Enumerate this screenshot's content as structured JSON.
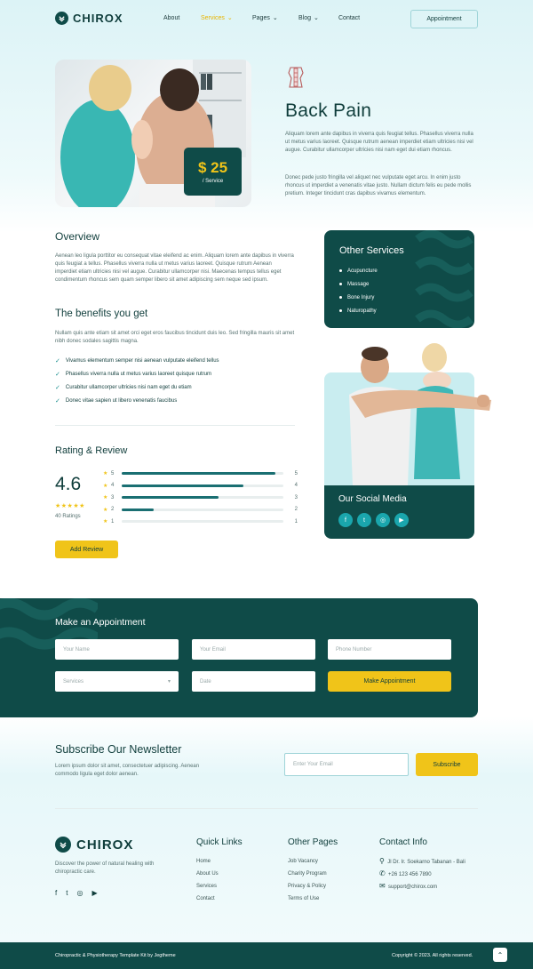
{
  "brand": {
    "name": "CHIROX"
  },
  "nav": {
    "items": [
      "About",
      "Services",
      "Pages",
      "Blog",
      "Contact"
    ],
    "active": "Services",
    "cta": "Appointment"
  },
  "hero": {
    "price": "$ 25",
    "price_unit": "/ Service",
    "title": "Back Pain",
    "p1": "Aliquam lorem ante dapibus in viverra quis feugiat tellus. Phasellus viverra nulla ut metus varius laoreet. Quisque rutrum aenean imperdiet etiam ultricies nisi vel augue. Curabitur ullamcorper ultricies nisi nam eget dui etiam rhoncus.",
    "p2": "Donec pede justo fringilla vel aliquet nec vulputate eget arcu. In enim justo rhoncus ut imperdiet a venenatis vitae justo. Nullam dictum felis eu pede mollis pretium. Integer tincidunt cras dapibus vivamus elementum."
  },
  "overview": {
    "title": "Overview",
    "text": "Aenean leo ligula porttitor eu consequat vitae eleifend ac enim. Aliquam lorem ante dapibus in viverra quis feugiat a tellus. Phasellus viverra nulla ut metus varius laoreet. Quisque rutrum Aenean imperdiet etiam ultricies nisi vel augue. Curabitur ullamcorper nisi. Maecenas tempus tellus eget condimentum rhoncus sem quam semper libero sit amet adipiscing sem neque sed ipsum."
  },
  "benefits": {
    "title": "The benefits you get",
    "text": "Nullam quis ante etiam sit amet orci eget eros faucibus tincidunt duis leo. Sed fringilla mauris sit amet nibh donec sodales sagittis magna.",
    "items": [
      "Vivamus elementum semper nisi aenean vulputate eleifend tellus",
      "Phasellus viverra nulla ut metus varius laoreet quisque rutrum",
      "Curabitur ullamcorper ultricies nisi nam eget du etiam",
      "Donec vitae sapien ut libero venenatis faucibus"
    ]
  },
  "rating": {
    "title": "Rating & Review",
    "score": "4.6",
    "count_label": "40 Ratings",
    "rows": [
      {
        "star": "5",
        "fill": 0.95,
        "count": "5"
      },
      {
        "star": "4",
        "fill": 0.75,
        "count": "4"
      },
      {
        "star": "3",
        "fill": 0.6,
        "count": "3"
      },
      {
        "star": "2",
        "fill": 0.2,
        "count": "2"
      },
      {
        "star": "1",
        "fill": 0.0,
        "count": "1"
      }
    ],
    "button": "Add Review"
  },
  "other_services": {
    "title": "Other Services",
    "items": [
      "Acupuncture",
      "Massage",
      "Bone Injury",
      "Naturopathy"
    ]
  },
  "social": {
    "title": "Our Social Media",
    "icons": [
      "f",
      "t",
      "◎",
      "▶"
    ]
  },
  "appointment": {
    "title": "Make an Appointment",
    "name_ph": "Your Name",
    "email_ph": "Your Email",
    "phone_ph": "Phone Number",
    "services_ph": "Services",
    "date_ph": "Date",
    "button": "Make Appointment"
  },
  "newsletter": {
    "title": "Subscribe Our Newsletter",
    "text": "Lorem ipsum dolor sit amet, consectetuer adipiscing. Aenean commodo ligula eget dolor aenean.",
    "email_ph": "Enter Your Email",
    "button": "Subscribe"
  },
  "footer": {
    "desc": "Discover the power of natural healing with chiropractic care.",
    "quick_title": "Quick Links",
    "quick": [
      "Home",
      "About Us",
      "Services",
      "Contact"
    ],
    "pages_title": "Other Pages",
    "pages": [
      "Job Vacancy",
      "Charity Program",
      "Privacy & Policy",
      "Terms of Use"
    ],
    "contact_title": "Contact Info",
    "address": "Jl Dr. Ir. Soekarno Tabanan - Bali",
    "phone": "+26 123 456 7890",
    "email": "support@chirox.com",
    "bottom_left": "Chiropractic & Physiotherapy Template Kit by Jegtheme",
    "bottom_right": "Copyright © 2023. All rights reserved."
  },
  "colors": {
    "primary": "#0f4b48",
    "accent": "#f0c419",
    "teal": "#1aa6ad"
  }
}
